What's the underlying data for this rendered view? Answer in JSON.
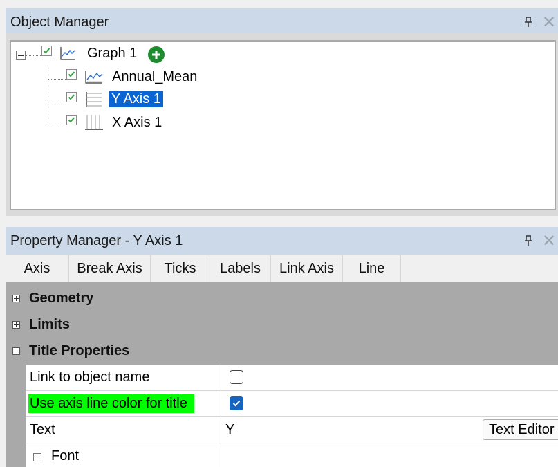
{
  "object_manager": {
    "title": "Object Manager",
    "tree": {
      "root": {
        "label": "Graph 1",
        "checked": true
      },
      "children": [
        {
          "label": "Annual_Mean",
          "checked": true,
          "icon": "line-plot-icon"
        },
        {
          "label": "Y Axis 1",
          "checked": true,
          "icon": "y-axis-icon",
          "selected": true
        },
        {
          "label": "X Axis 1",
          "checked": true,
          "icon": "x-axis-icon"
        }
      ]
    }
  },
  "property_manager": {
    "title": "Property Manager - Y Axis 1",
    "tabs": [
      {
        "label": "Axis",
        "active": true
      },
      {
        "label": "Break Axis"
      },
      {
        "label": "Ticks"
      },
      {
        "label": "Labels"
      },
      {
        "label": "Link Axis"
      },
      {
        "label": "Line"
      }
    ],
    "categories": [
      {
        "label": "Geometry",
        "expanded": false
      },
      {
        "label": "Limits",
        "expanded": false
      },
      {
        "label": "Title Properties",
        "expanded": true
      }
    ],
    "properties": {
      "link_to_object_name": {
        "label": "Link to object name",
        "checked": false
      },
      "use_axis_line_color": {
        "label": "Use axis line color for title",
        "checked": true,
        "highlight_color": "#00ff00"
      },
      "text": {
        "label": "Text",
        "value": "Y",
        "button": "Text Editor"
      },
      "font": {
        "label": "Font"
      }
    }
  },
  "colors": {
    "titlebar": "#ccd9e8",
    "selection": "#0a64d2",
    "add_button": "#1e8c2e",
    "checkbox_checked": "#1565c0"
  }
}
